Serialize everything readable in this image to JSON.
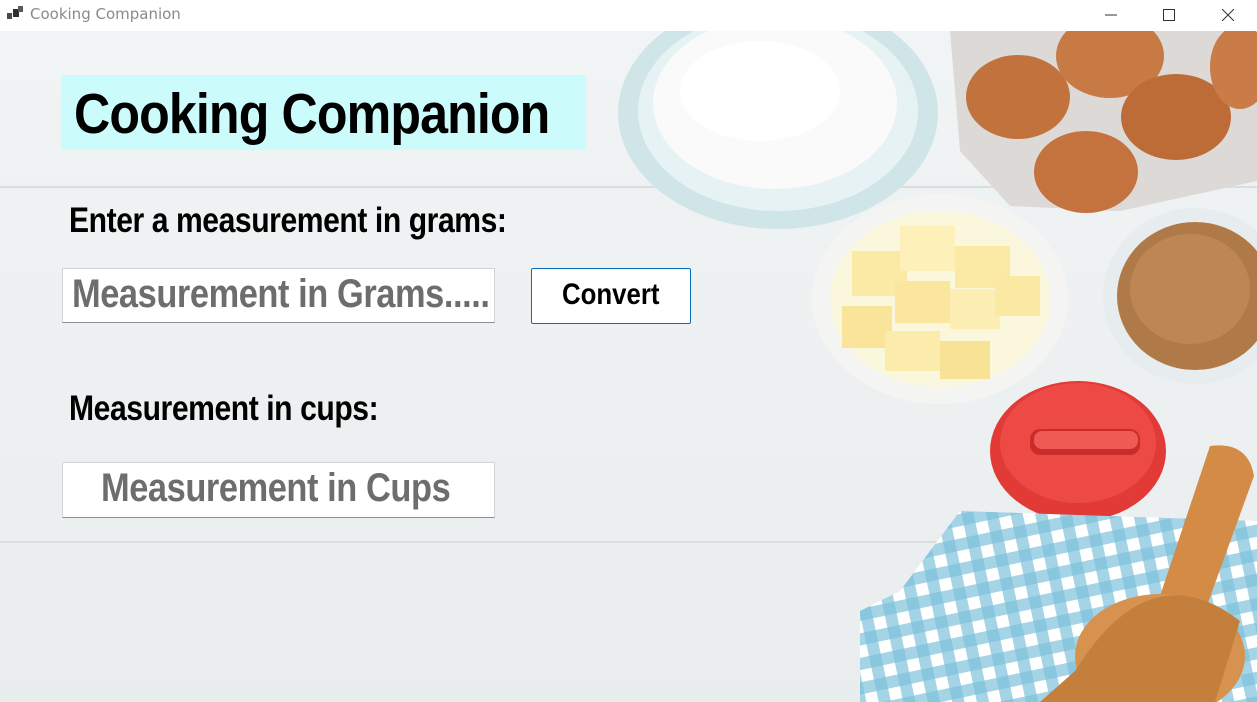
{
  "window": {
    "title": "Cooking Companion",
    "controls": [
      "minimize",
      "maximize",
      "close"
    ]
  },
  "form": {
    "heading": "Cooking Companion",
    "grams_label": "Enter a measurement in grams:",
    "grams_input_placeholder": "Measurement in Grams.....",
    "convert_button": "Convert",
    "cups_label": "Measurement in cups:",
    "cups_output": "Measurement in Cups"
  },
  "colors": {
    "heading_background": "#ccfbfb",
    "button_border": "#0b6cc0",
    "placeholder_text": "#6d6d6d"
  },
  "background": {
    "description_items": [
      "flour-bowl",
      "egg-carton",
      "butter-bowl",
      "brown-sugar-bowl",
      "kitchen-timer",
      "checkered-towel",
      "rolling-pin"
    ]
  }
}
